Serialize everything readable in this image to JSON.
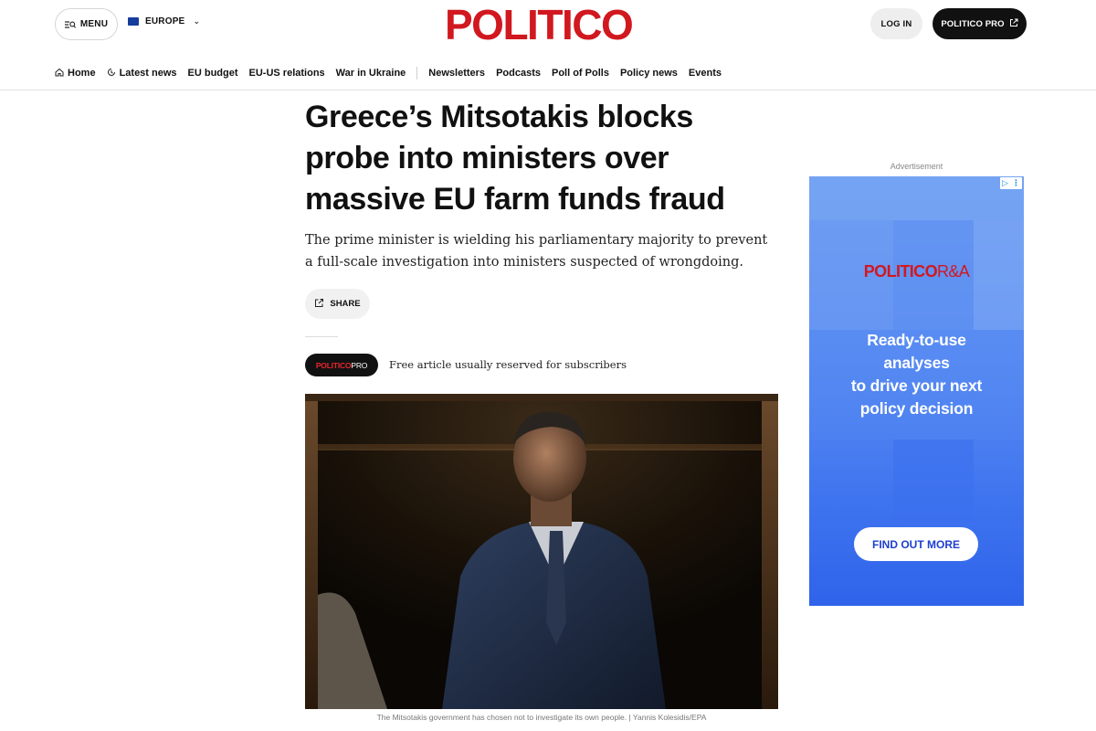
{
  "header": {
    "menu_label": "MENU",
    "edition_label": "EUROPE",
    "logo_text": "POLITICO",
    "login_label": "LOG IN",
    "pro_label": "POLITICO PRO"
  },
  "nav": {
    "items": [
      {
        "label": "Home",
        "icon": "home-icon"
      },
      {
        "label": "Latest news",
        "icon": "clock-icon"
      },
      {
        "label": "EU budget"
      },
      {
        "label": "EU-US relations"
      },
      {
        "label": "War in Ukraine"
      },
      {
        "label": "Newsletters"
      },
      {
        "label": "Podcasts"
      },
      {
        "label": "Poll of Polls"
      },
      {
        "label": "Policy news"
      },
      {
        "label": "Events"
      }
    ]
  },
  "article": {
    "headline": "Greece’s Mitsotakis blocks probe into ministers over massive EU farm funds fraud",
    "dek": "The prime minister is wielding his parliamentary majority to prevent a full-scale investigation into ministers suspected of wrongdoing.",
    "share_label": "SHARE",
    "pro_badge_red": "POLITICO",
    "pro_badge_white": "PRO",
    "free_note": "Free article usually reserved for subscribers",
    "image_caption": "The Mitsotakis government has chosen not to investigate its own people. | Yannis Kolesidis/EPA"
  },
  "ad": {
    "label": "Advertisement",
    "logo_red": "POLITICO",
    "logo_thin": "R&A",
    "copy_lines": [
      "Ready-to-use",
      "analyses",
      "to drive your next",
      "policy decision"
    ],
    "cta_label": "FIND OUT MORE"
  },
  "colors": {
    "brand_red": "#d1181f",
    "pro_black": "#111111",
    "ad_blue": "#3f74ef"
  }
}
